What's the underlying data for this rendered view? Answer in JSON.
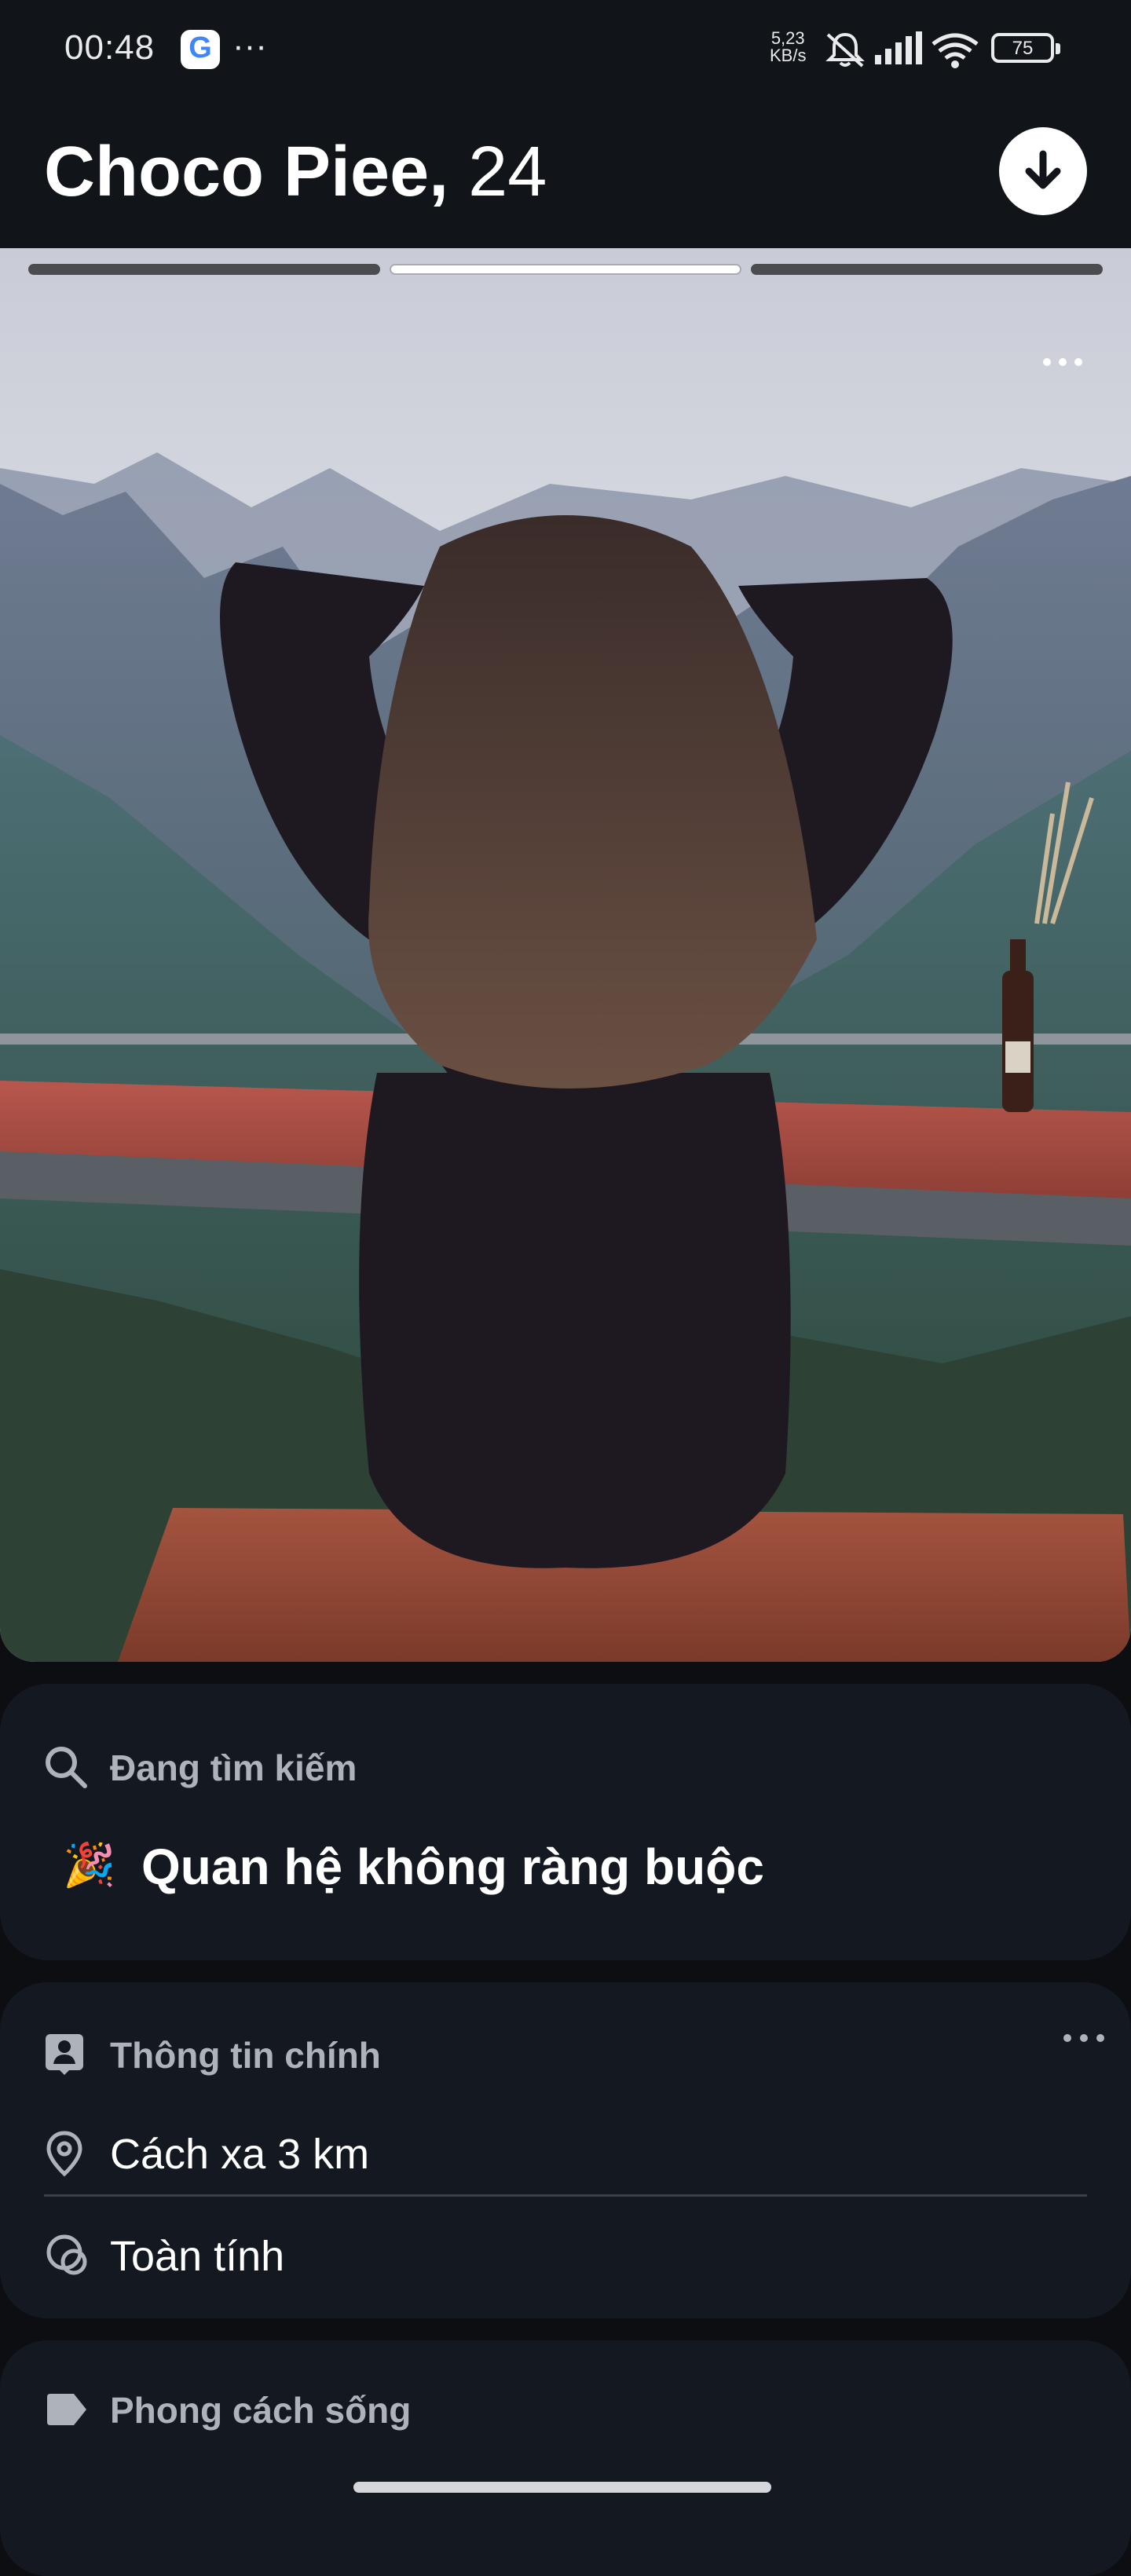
{
  "status_bar": {
    "time": "00:48",
    "google_glyph": "G",
    "more_glyph": "···",
    "net_speed_value": "5,23",
    "net_speed_unit": "KB/s",
    "battery": "75",
    "icons": [
      "google-app-icon",
      "bell-muted-icon",
      "signal-icon",
      "wifi-icon",
      "battery-icon"
    ]
  },
  "profile": {
    "name": "Choco Piee,",
    "age": "24"
  },
  "photo": {
    "progress_total": 3,
    "progress_current": 2
  },
  "looking_for": {
    "label": "Đang tìm kiếm",
    "emoji": "🎉",
    "value": "Quan hệ không ràng buộc"
  },
  "basics": {
    "label": "Thông tin chính",
    "distance": "Cách xa 3 km",
    "gender": "Toàn tính"
  },
  "lifestyle": {
    "label": "Phong cách sống"
  },
  "colors": {
    "background": "#0c0e12",
    "card": "#141820",
    "label": "#aeb3bb"
  }
}
